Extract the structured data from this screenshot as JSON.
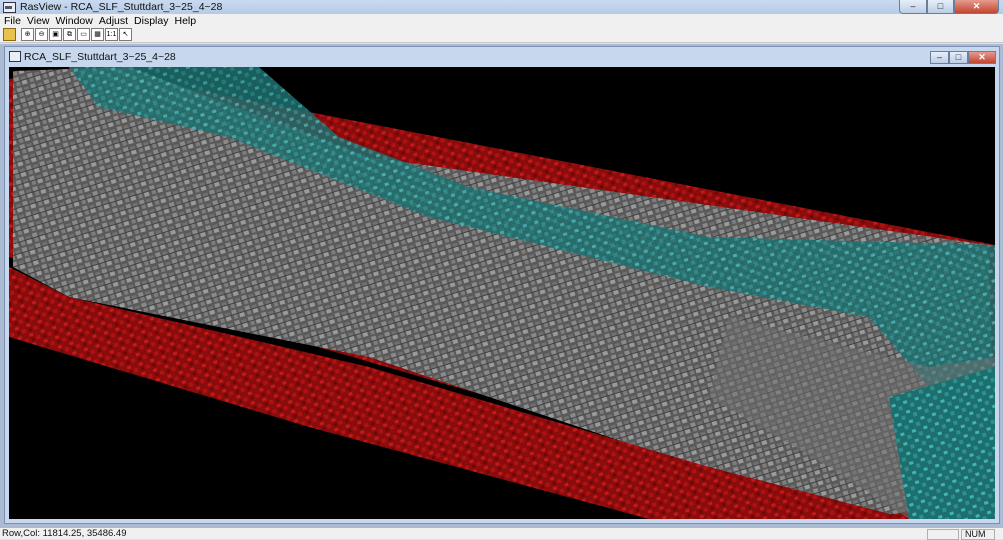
{
  "app": {
    "title": "RasView - RCA_SLF_Stuttdart_3~25_4~28"
  },
  "window_controls": {
    "minimize": "–",
    "maximize": "□",
    "close": "✕"
  },
  "menu": {
    "items": [
      "File",
      "View",
      "Window",
      "Adjust",
      "Display",
      "Help"
    ]
  },
  "toolbar": {
    "buttons": [
      {
        "name": "open-icon",
        "glyph": ""
      },
      {
        "name": "zoom-in-icon",
        "glyph": "⊕"
      },
      {
        "name": "zoom-out-icon",
        "glyph": "⊖"
      },
      {
        "name": "fit-window-icon",
        "glyph": "▣"
      },
      {
        "name": "pan-icon",
        "glyph": "⧉"
      },
      {
        "name": "view-one-icon",
        "glyph": "▭"
      },
      {
        "name": "view-grid-icon",
        "glyph": "▦"
      },
      {
        "name": "actual-size-icon",
        "glyph": "1:1"
      },
      {
        "name": "pointer-icon",
        "glyph": "↖"
      }
    ]
  },
  "document": {
    "title": "RCA_SLF_Stuttdart_3~25_4~28",
    "image_content": "anaglyph aerial image"
  },
  "status": {
    "coords": "Row,Col: 11814.25, 35486.49",
    "num": "NUM"
  }
}
